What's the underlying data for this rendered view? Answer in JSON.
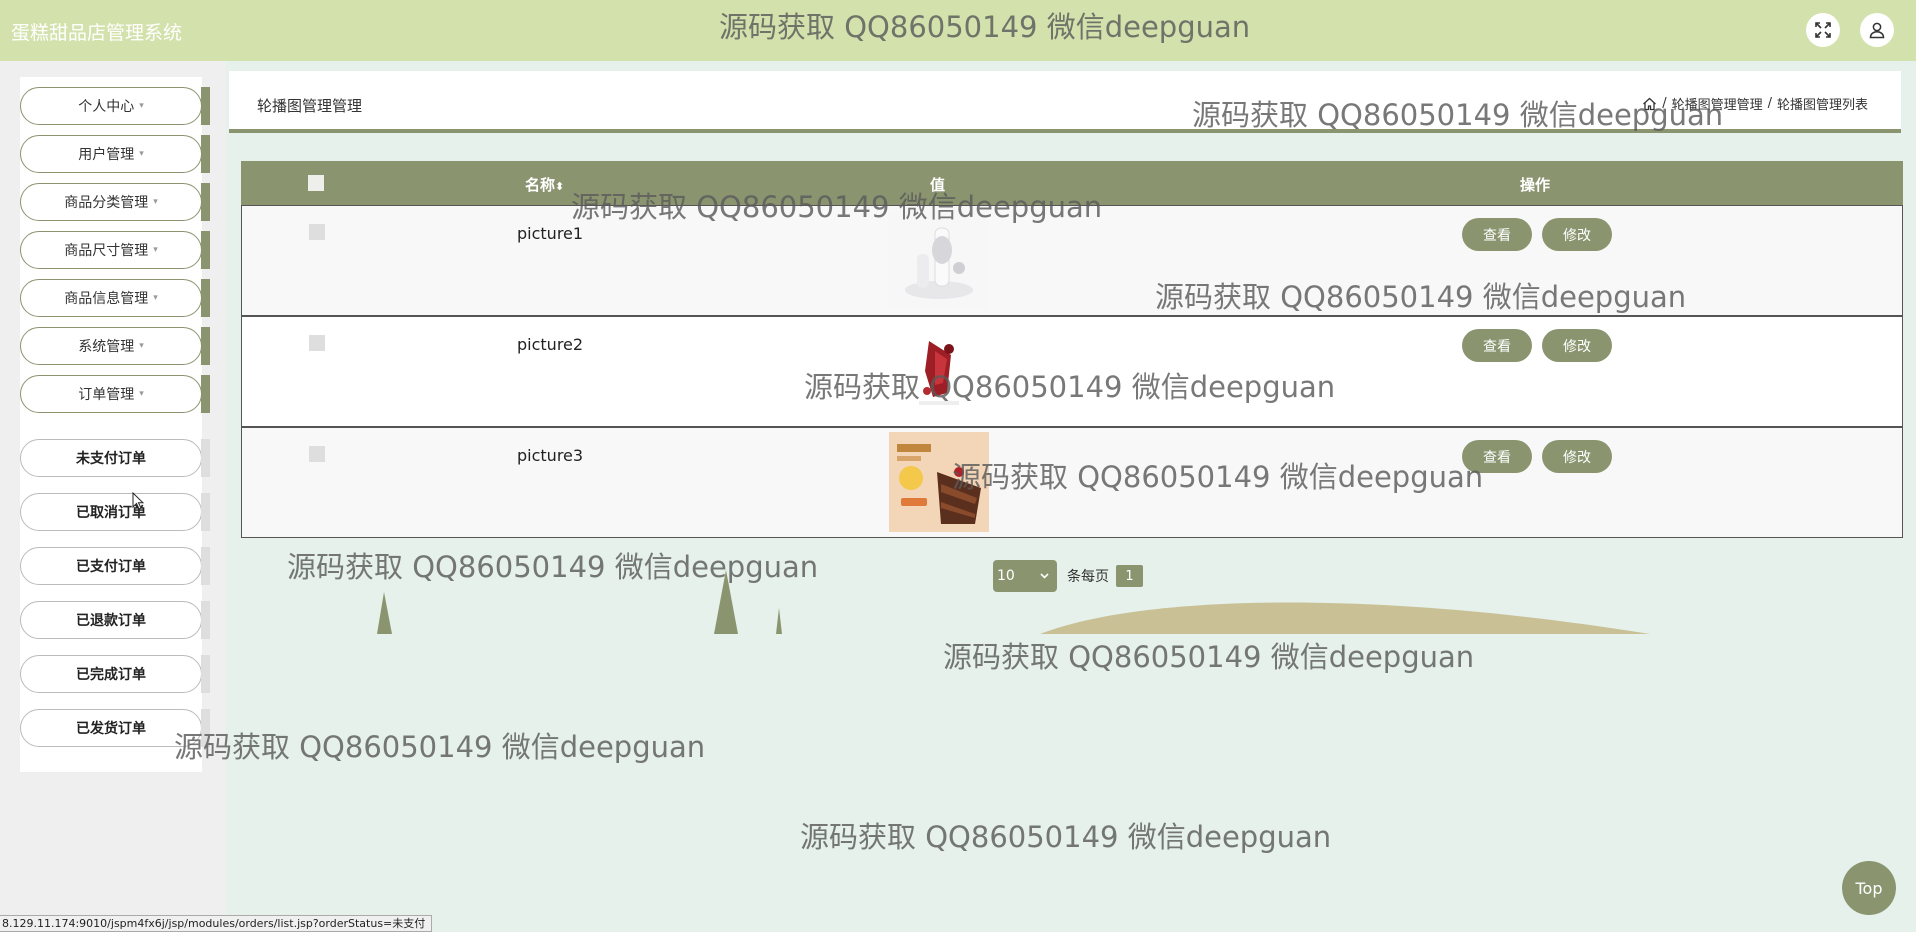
{
  "header": {
    "app_title": "蛋糕甜品店管理系统",
    "fullscreen_icon": "fullscreen-icon",
    "user_icon": "user-icon"
  },
  "sidebar": {
    "items": [
      {
        "label": "个人中心"
      },
      {
        "label": "用户管理"
      },
      {
        "label": "商品分类管理"
      },
      {
        "label": "商品尺寸管理"
      },
      {
        "label": "商品信息管理"
      },
      {
        "label": "系统管理"
      },
      {
        "label": "订单管理"
      }
    ],
    "caret": "▾",
    "sub_items": [
      {
        "label": "未支付订单"
      },
      {
        "label": "已取消订单"
      },
      {
        "label": "已支付订单"
      },
      {
        "label": "已退款订单"
      },
      {
        "label": "已完成订单"
      },
      {
        "label": "已发货订单"
      }
    ]
  },
  "content": {
    "title": "轮播图管理管理",
    "breadcrumb": {
      "home_icon": "home-icon",
      "separator": "/",
      "level1": "轮播图管理管理",
      "level2": "轮播图管理列表"
    }
  },
  "table": {
    "columns": {
      "name": "名称",
      "sort_icon": "⬍",
      "value": "值",
      "actions": "操作"
    },
    "rows": [
      {
        "name": "picture1",
        "image": "white-cream-cake-image"
      },
      {
        "name": "picture2",
        "image": "red-fruit-dessert-image"
      },
      {
        "name": "picture3",
        "image": "chocolate-cake-image"
      }
    ],
    "view_label": "查看",
    "edit_label": "修改"
  },
  "pagination": {
    "page_size": "10",
    "per_page_label": "条每页",
    "current_page": "1"
  },
  "watermark": "源码获取 QQ86050149 微信deepguan",
  "top_button": "Top",
  "status_url": "8.129.11.174:9010/jspm4fx6j/jsp/modules/orders/list.jsp?orderStatus=未支付",
  "colors": {
    "topbar": "#d3e2ac",
    "accent": "#8a9570",
    "page_bg": "#e5f1ea",
    "sidebar_bg": "#efefef",
    "decor": "#c9c096"
  }
}
